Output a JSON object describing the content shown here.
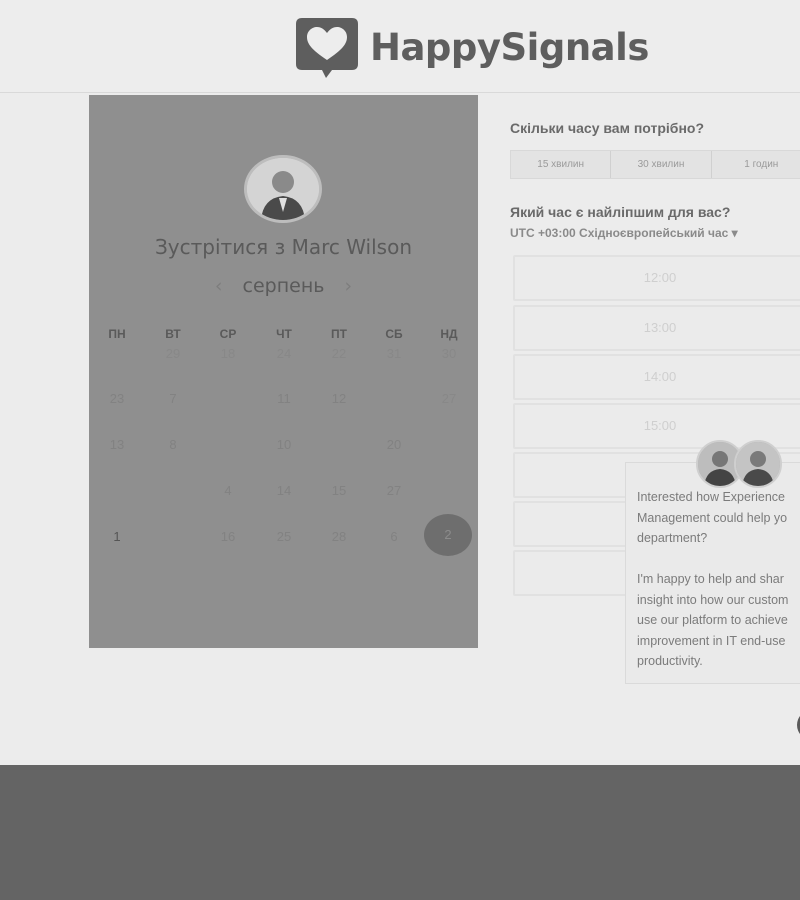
{
  "brand": {
    "name": "HappySignals"
  },
  "scheduler": {
    "meet_title": "Зустрітися з Marc Wilson",
    "month": "серпень",
    "prev_label": "‹",
    "next_label": "›",
    "weekdays": [
      "ПН",
      "ВТ",
      "СР",
      "ЧТ",
      "ПТ",
      "СБ",
      "НД"
    ],
    "weeks": [
      [
        "",
        "29",
        "18",
        "24",
        "22",
        "31",
        "30"
      ],
      [
        "23",
        "7",
        "",
        "11",
        "12",
        "",
        "27"
      ],
      [
        "13",
        "8",
        "",
        "10",
        "",
        "20",
        ""
      ],
      [
        "",
        "",
        "4",
        "14",
        "15",
        "27",
        ""
      ],
      [
        "1",
        "",
        "16",
        "25",
        "28",
        "6",
        "2"
      ]
    ],
    "selected_day": "2"
  },
  "booking": {
    "duration_question": "Скільки часу вам потрібно?",
    "durations": [
      "15 хвилин",
      "30 хвилин",
      "1 годин"
    ],
    "time_question": "Який час є найліпшим для вас?",
    "timezone": "UTC +03:00 Східноєвропейський час ▾",
    "slots": [
      "12:00",
      "13:00",
      "14:00",
      "15:00",
      "",
      "",
      ""
    ]
  },
  "chat": {
    "message": "Interested how Experience\nManagement could help yo\ndepartment?\n\nI'm happy to help and shar\ninsight into how our custom\nuse our platform to achieve\nimprovement in IT end-use\nproductivity."
  }
}
